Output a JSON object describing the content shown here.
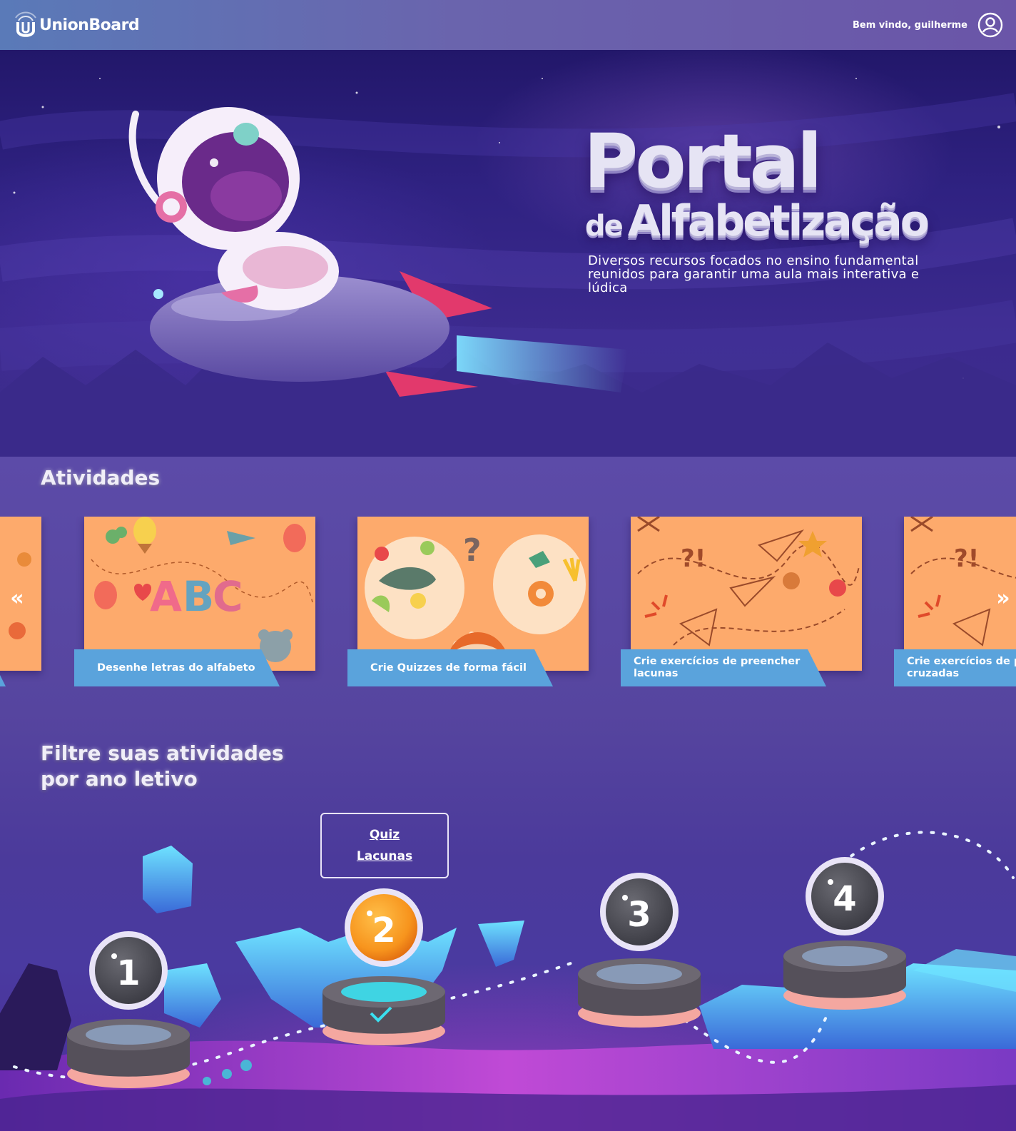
{
  "header": {
    "brand": "UnionBoard",
    "brand_union": "Union",
    "brand_board": "Board",
    "welcome": "Bem vindo, guilherme"
  },
  "hero": {
    "title_line1": "Portal",
    "title_line2_small": "de",
    "title_line2_big": "Alfabetização",
    "subtitle": "Diversos recursos focados no ensino fundamental reunidos para garantir uma aula mais interativa e lúdica"
  },
  "activities": {
    "title": "Atividades",
    "cards": [
      {
        "label": "Desenhe letras do alfabeto"
      },
      {
        "label": "Crie Quizzes de forma fácil"
      },
      {
        "label": "Crie exercícios de preencher lacunas"
      },
      {
        "label": "Crie exercícios de palavras cruzadas"
      }
    ],
    "prev_icon": "«",
    "next_icon": "»"
  },
  "filter": {
    "title_line1": "Filtre suas atividades",
    "title_line2": "por ano letivo",
    "links": [
      "Quiz",
      "Lacunas"
    ],
    "levels": [
      "1",
      "2",
      "3",
      "4"
    ],
    "active_level": "2"
  },
  "colors": {
    "accent_orange": "#f7941d",
    "label_blue": "#5aa3dc",
    "header_start": "#5a7ab8",
    "header_end": "#6a55a8",
    "card_bg": "#fdaa6c"
  }
}
